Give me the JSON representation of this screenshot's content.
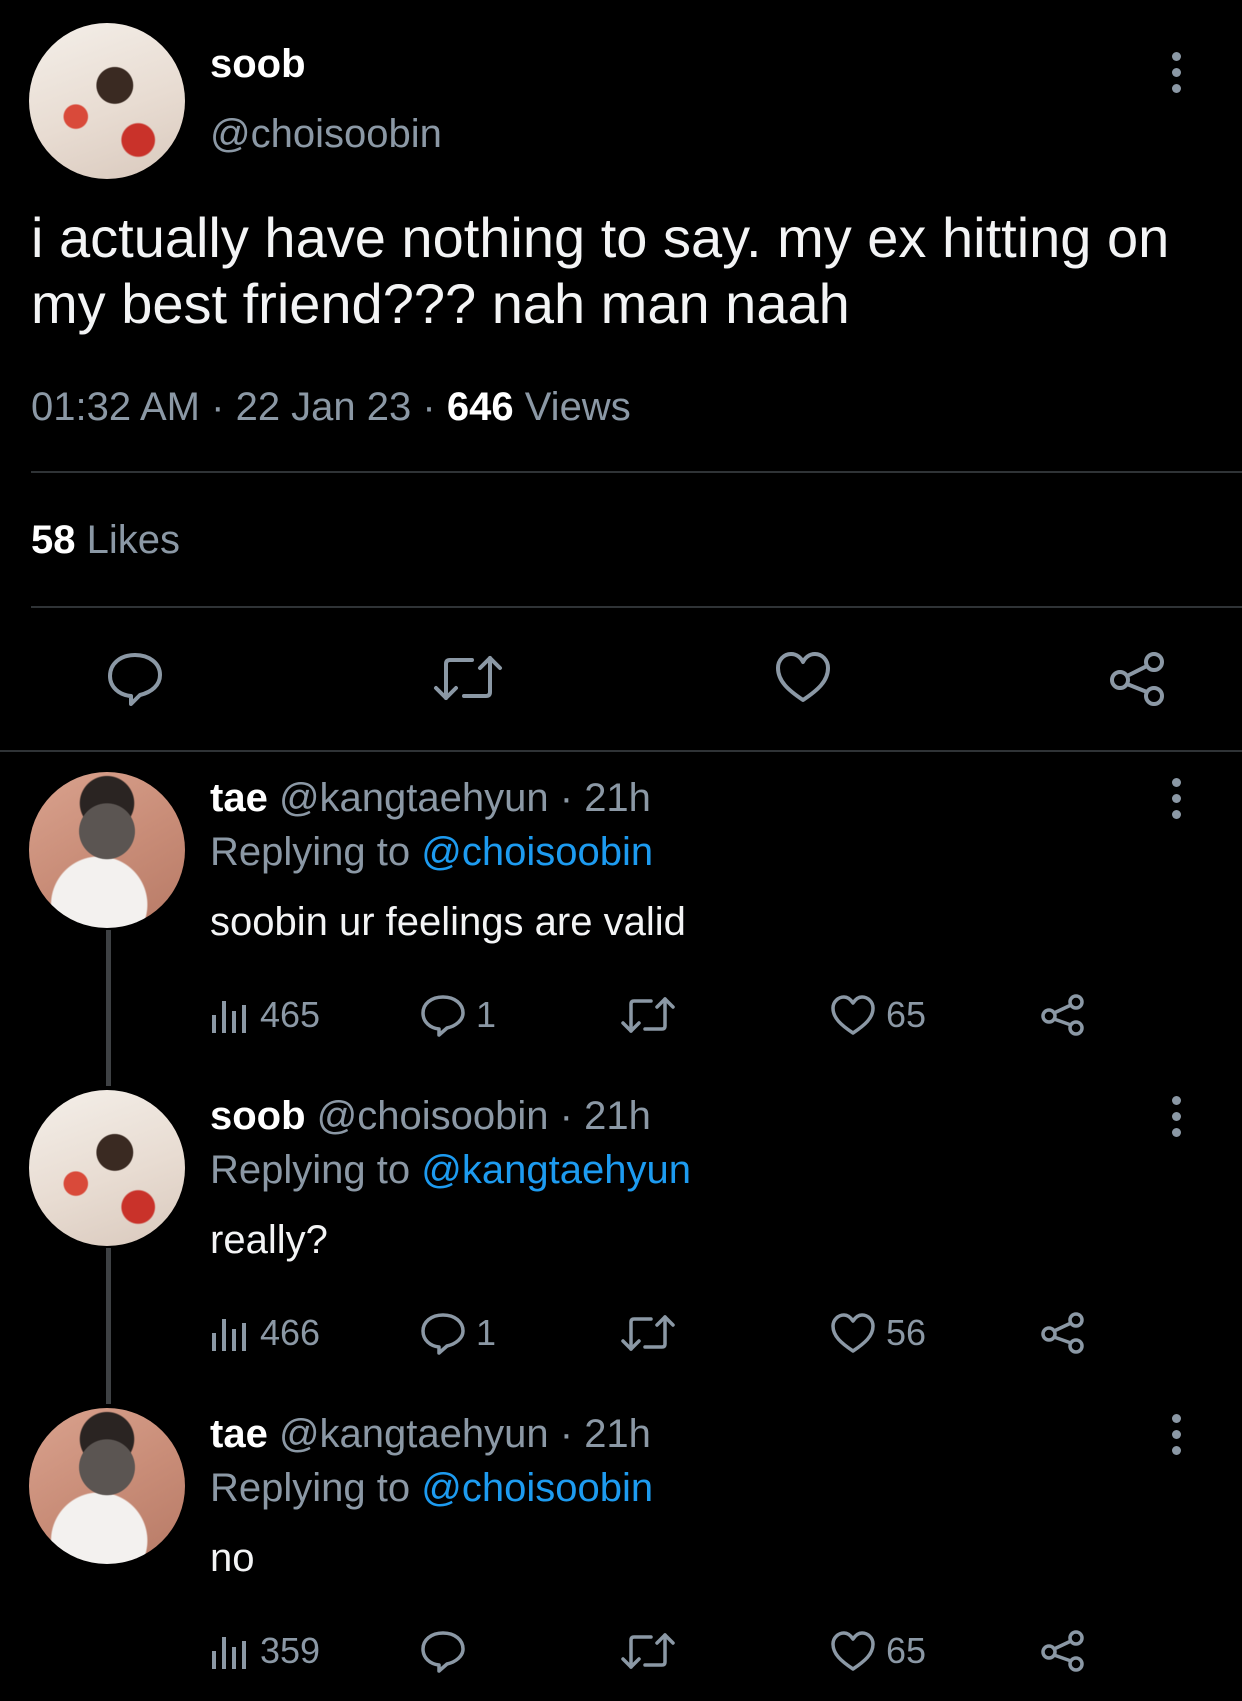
{
  "main_tweet": {
    "author_name": "soob",
    "author_handle": "@choisoobin",
    "text": "i actually have nothing to say. my ex hitting on my best friend??? nah man naah",
    "time": "01:32 AM",
    "date": "22 Jan 23",
    "views_count": "646",
    "views_label": "Views",
    "likes_count": "58",
    "likes_label": "Likes"
  },
  "replies": [
    {
      "author_name": "tae",
      "author_handle": "@kangtaehyun",
      "age": "21h",
      "replying_prefix": "Replying to",
      "replying_to": "@choisoobin",
      "text": "soobin ur feelings are valid",
      "views": "465",
      "replies": "1",
      "retweets": "",
      "likes": "65"
    },
    {
      "author_name": "soob",
      "author_handle": "@choisoobin",
      "age": "21h",
      "replying_prefix": "Replying to",
      "replying_to": "@kangtaehyun",
      "text": "really?",
      "views": "466",
      "replies": "1",
      "retweets": "",
      "likes": "56"
    },
    {
      "author_name": "tae",
      "author_handle": "@kangtaehyun",
      "age": "21h",
      "replying_prefix": "Replying to",
      "replying_to": "@choisoobin",
      "text": "no",
      "views": "359",
      "replies": "",
      "retweets": "",
      "likes": "65"
    }
  ],
  "icons": {
    "more": "more-vertical-icon",
    "reply": "comment-bubble-icon",
    "retweet": "retweet-icon",
    "like": "heart-icon",
    "share": "share-icon",
    "views": "views-bar-chart-icon"
  },
  "colors": {
    "background": "#000000",
    "primary_text": "#e7e9ea",
    "secondary_text": "#8b98a5",
    "link": "#1d9bf0",
    "divider": "#2f3336"
  }
}
